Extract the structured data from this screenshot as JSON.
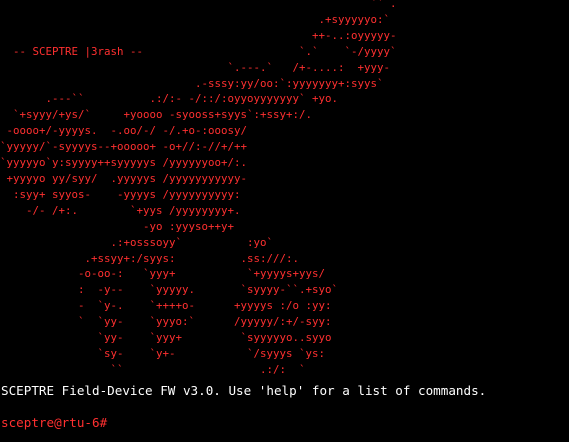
{
  "ascii_art": {
    "lines": [
      "                                                         `` .",
      "                                                 .+syyyyyo:`",
      "                                                ++-..:oyyyyy-",
      "  -- SCEPTRE |3rash --                        `.`    `-/yyyy`",
      "                                   `.---.`   /+-....:  +yyy-",
      "                              .-sssy:yy/oo:`:yyyyyyy+:syys`",
      "       .---``          .:/:- -/::/:oyyoyyyyyyy` +yo.",
      "  `+syyy/+ys/`     +yoooo -syooss+syys`:+ssy+:/.",
      " -oooo+/-yyyys.  -.oo/-/ -/.+o-:ooosy/",
      "`yyyyy/`-syyyys--+ooooo+ -o+//:-//+/++",
      "`yyyyyo`y:syyyy++syyyyys /yyyyyyoo+/:.",
      " +yyyyo yy/syy/  .yyyyys /yyyyyyyyyyy-",
      "  :syy+ syyos-    -yyyys /yyyyyyyyyy:",
      "    -/- /+:.        `+yys /yyyyyyyy+.",
      "                      -yo :yyyso++y+",
      "                 .:+osssoyy`          :yo`",
      "             .+ssyy+:/syys:          .ss:///:.",
      "            -o-oo-:   `yyy+           `+yyyys+yys/",
      "            :  -y--    `yyyyy.       `syyyy-``.+syo`",
      "            -  `y-.    `++++o-      +yyyys :/o :yy:",
      "            `  `yy-    `yyyo:`      /yyyyy/:+/-syy:",
      "               `yy-    `yyy+         `syyyyyo..syyo",
      "               `sy-    `y+-           `/syyys `ys:",
      "                 ``                     .:/:  `"
    ]
  },
  "banner": {
    "text": "SCEPTRE Field-Device FW v3.0. Use 'help' for a list of commands."
  },
  "prompt": {
    "text": "sceptre@rtu-6#",
    "input_value": ""
  },
  "colors": {
    "background": "#000000",
    "accent": "#ff3030",
    "text": "#ffffff"
  }
}
